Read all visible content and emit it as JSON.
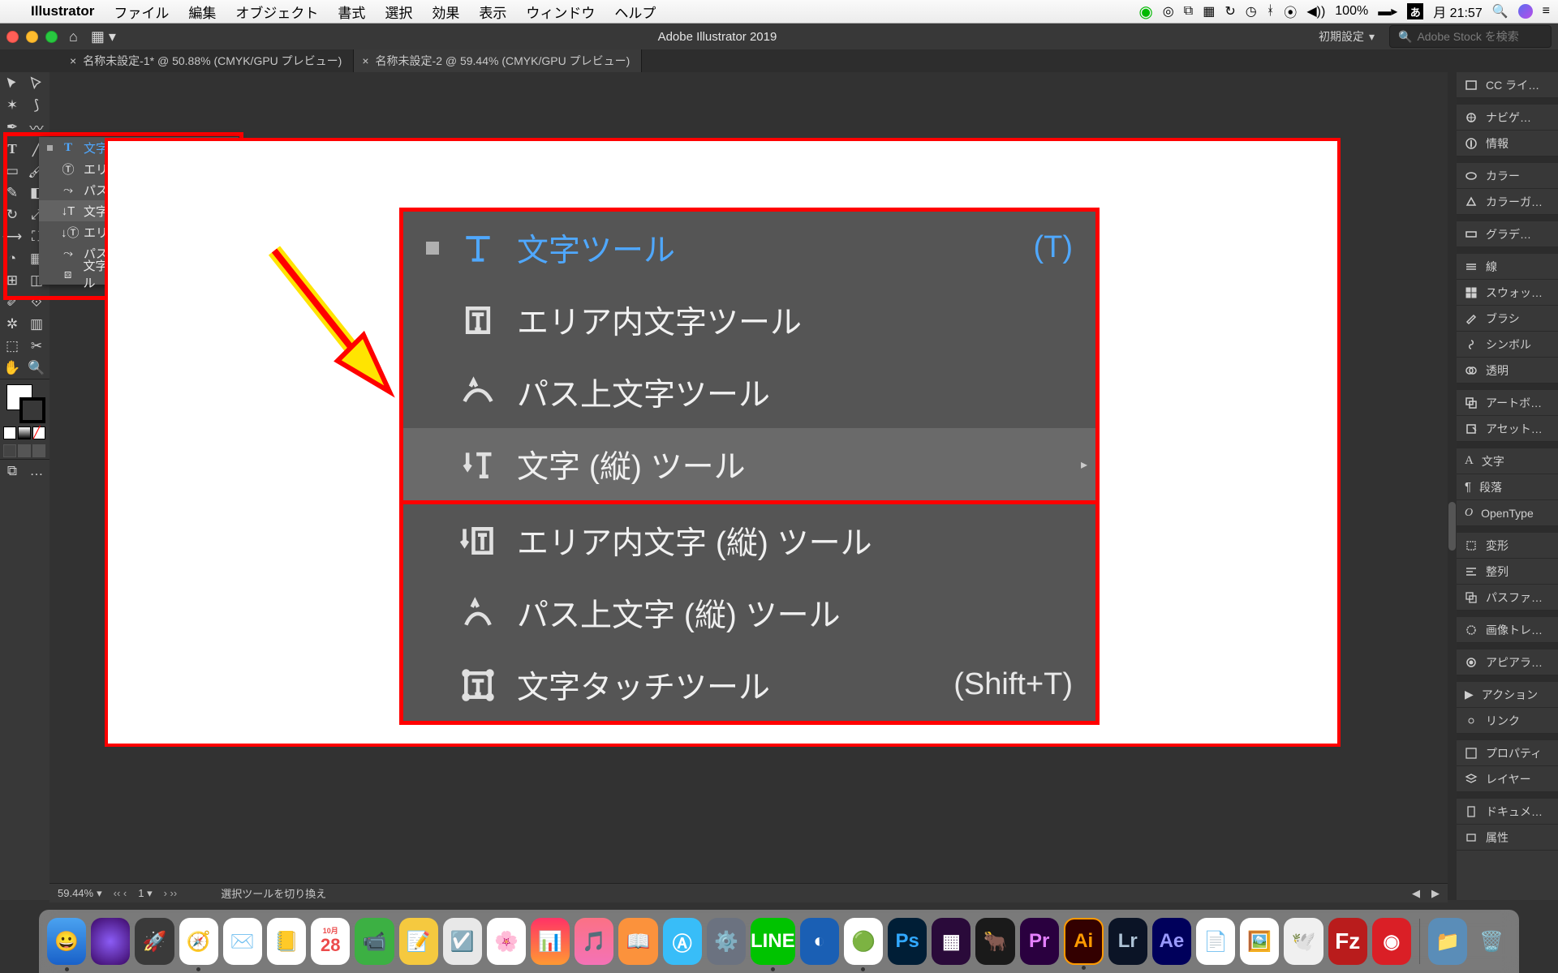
{
  "menubar": {
    "app": "Illustrator",
    "items": [
      "ファイル",
      "編集",
      "オブジェクト",
      "書式",
      "選択",
      "効果",
      "表示",
      "ウィンドウ",
      "ヘルプ"
    ],
    "battery": "100%",
    "clock": "月 21:57",
    "date_text": "あ"
  },
  "app_bar": {
    "title": "Adobe Illustrator 2019",
    "workspace": "初期設定",
    "search_placeholder": "Adobe Stock を検索"
  },
  "tabs": [
    {
      "label": "名称未設定-1* @ 50.88% (CMYK/GPU プレビュー)",
      "active": false
    },
    {
      "label": "名称未設定-2 @ 59.44% (CMYK/GPU プレビュー)",
      "active": true
    }
  ],
  "type_submenu": [
    {
      "label": "文字ツール",
      "shortcut": "(T)",
      "top": true
    },
    {
      "label": "エリア内文字ツール"
    },
    {
      "label": "パス上文字ツール"
    },
    {
      "label": "文字 (縦) ツール",
      "selected": true,
      "submenu": true
    },
    {
      "label": "エリア内文字 (縦) ツール"
    },
    {
      "label": "パス上文字 (縦) ツール"
    },
    {
      "label": "文字タッチツール",
      "shortcut": "(Shift+T)"
    }
  ],
  "right_panels": [
    "CC ライ…",
    "ナビゲ…",
    "情報",
    "カラー",
    "カラーガ…",
    "グラデ…",
    "線",
    "スウォッ…",
    "ブラシ",
    "シンボル",
    "透明",
    "アートボ…",
    "アセット…",
    "文字",
    "段落",
    "OpenType",
    "変形",
    "整列",
    "パスファ…",
    "画像トレ…",
    "アピアラ…",
    "アクション",
    "リンク",
    "プロパティ",
    "レイヤー",
    "ドキュメ…",
    "属性"
  ],
  "status": {
    "zoom": "59.44%",
    "nav_left": "‹‹ ‹",
    "artboard": "1",
    "nav_right": "› ››",
    "hint": "選択ツールを切り換え"
  },
  "dock_cal_day": "28"
}
